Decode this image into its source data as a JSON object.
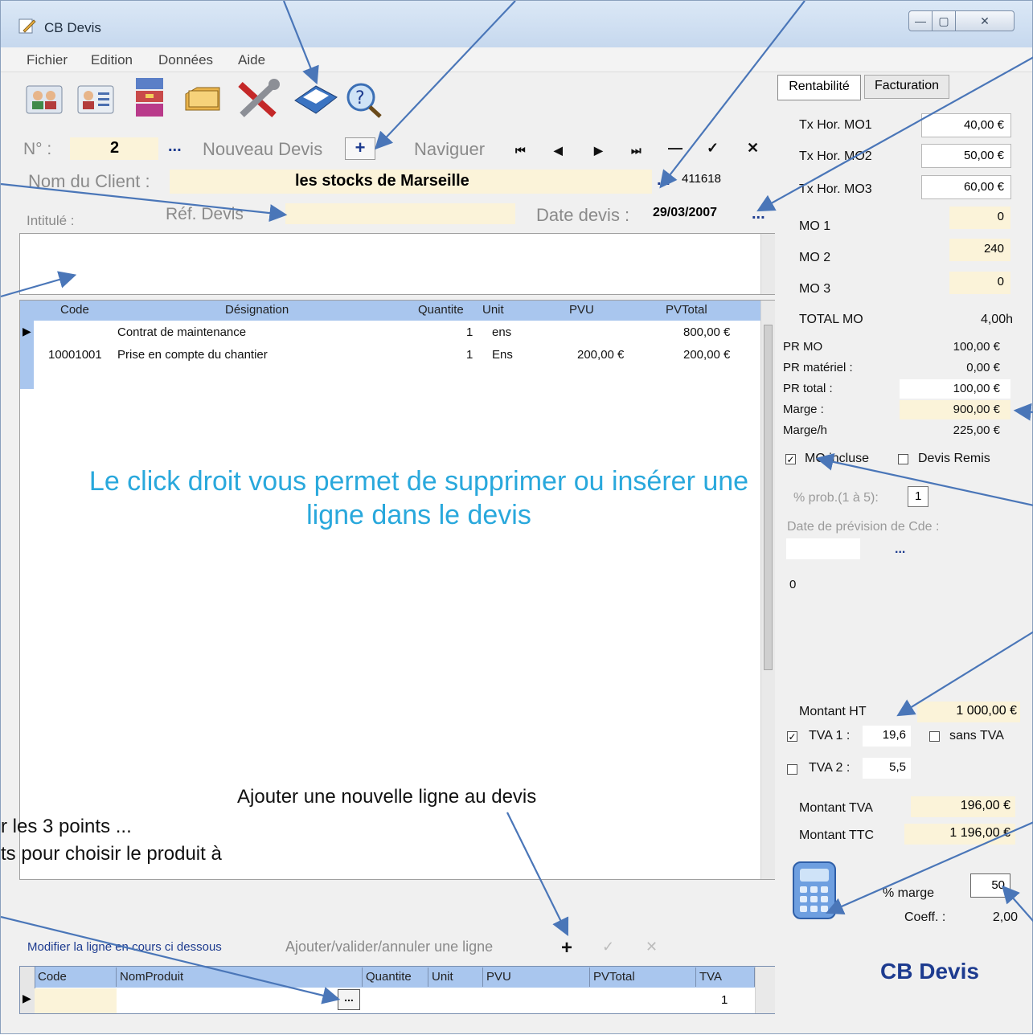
{
  "window": {
    "title": "CB Devis",
    "controls": [
      "—",
      "▢",
      "✕"
    ]
  },
  "menu": [
    "Fichier",
    "Edition",
    "Données",
    "Aide"
  ],
  "toolbar": {
    "icons": [
      "clients-icon",
      "contact-card-icon",
      "archive-icon",
      "folders-icon",
      "tools-icon",
      "printer-icon",
      "help-search-icon"
    ]
  },
  "header": {
    "num_label": "N° :",
    "num_value": "2",
    "dots": "...",
    "new_label": "Nouveau Devis",
    "new_btn": "+",
    "nav_label": "Naviguer",
    "nav_buttons": [
      "⏮",
      "◀",
      "▶",
      "⏭",
      "—",
      "✓",
      "✕"
    ],
    "client_label": "Nom du Client :",
    "client_value": "les stocks de  Marseille",
    "client_code": "411618",
    "intitule_label": "Intitulé  :",
    "ref_label": "Réf. Devis",
    "date_label": "Date devis :",
    "date_value": "29/03/2007"
  },
  "grid": {
    "columns": [
      "Code",
      "Désignation",
      "Quantite",
      "Unit",
      "PVU",
      "PVTotal"
    ],
    "rows": [
      {
        "code": "",
        "designation": "Contrat de maintenance",
        "quantite": "1",
        "unit": "ens",
        "pvu": "",
        "pvtotal": "800,00 €"
      },
      {
        "code": "10001001",
        "designation": "Prise en compte du chantier",
        "quantite": "1",
        "unit": "Ens",
        "pvu": "200,00 €",
        "pvtotal": "200,00 €"
      }
    ]
  },
  "annotations": {
    "right_click": "Le click droit vous permet de supprimer ou insérer une ligne dans le devis",
    "add_line": "Ajouter une nouvelle ligne au devis",
    "points_1": "r les 3 points ...",
    "points_2": "ts pour choisir le produit à"
  },
  "bottom": {
    "modify_label": "Modifier la ligne en cours ci dessous",
    "addval_label": "Ajouter/valider/annuler une ligne",
    "plus": "+",
    "check": "✓",
    "cross": "✕",
    "columns": [
      "Code",
      "NomProduit",
      "Quantite",
      "Unit",
      "PVU",
      "PVTotal",
      "TVA"
    ],
    "tva_value": "1",
    "dots": "..."
  },
  "right": {
    "tabs": [
      "Rentabilité",
      "Facturation"
    ],
    "tx": [
      {
        "label": "Tx Hor. MO1",
        "value": "40,00 €"
      },
      {
        "label": "Tx Hor. MO2",
        "value": "50,00 €"
      },
      {
        "label": "Tx Hor. MO3",
        "value": "60,00 €"
      }
    ],
    "mo": [
      {
        "label": "MO 1",
        "value": "0"
      },
      {
        "label": "MO 2",
        "value": "240"
      },
      {
        "label": "MO 3",
        "value": "0"
      }
    ],
    "total_mo_label": "TOTAL MO",
    "total_mo_value": "4,00h",
    "pr_mo_label": "PR MO",
    "pr_mo_value": "100,00 €",
    "pr_mat_label": "PR matériel :",
    "pr_mat_value": "0,00 €",
    "pr_total_label": "PR total :",
    "pr_total_value": "100,00 €",
    "marge_label": "Marge :",
    "marge_value": "900,00 €",
    "margeh_label": "Marge/h",
    "margeh_value": "225,00 €",
    "mo_incluse_label": "MO incluse",
    "devis_remis_label": "Devis Remis",
    "prob_label": "% prob.(1 à 5):",
    "prob_value": "1",
    "prevision_label": "Date de prévision de Cde :",
    "prevision_dots": "...",
    "zero": "0",
    "montant_ht_label": "Montant HT",
    "montant_ht_value": "1 000,00 €",
    "tva1_label": "TVA 1 :",
    "tva1_value": "19,6",
    "sans_tva_label": "sans TVA",
    "tva2_label": "TVA 2 :",
    "tva2_value": "5,5",
    "montant_tva_label": "Montant TVA",
    "montant_tva_value": "196,00 €",
    "montant_ttc_label": "Montant TTC",
    "montant_ttc_value": "1 196,00 €",
    "marge_pct_label": "% marge",
    "marge_pct_value": "50",
    "coeff_label": "Coeff. :",
    "coeff_value": "2,00",
    "brand": "CB Devis"
  },
  "colors": {
    "accent": "#29a8dc",
    "grid_header": "#a9c6ee",
    "field_yellow": "#fbf3d9",
    "brand": "#1d3b8f",
    "arrow": "#4a76b8"
  }
}
